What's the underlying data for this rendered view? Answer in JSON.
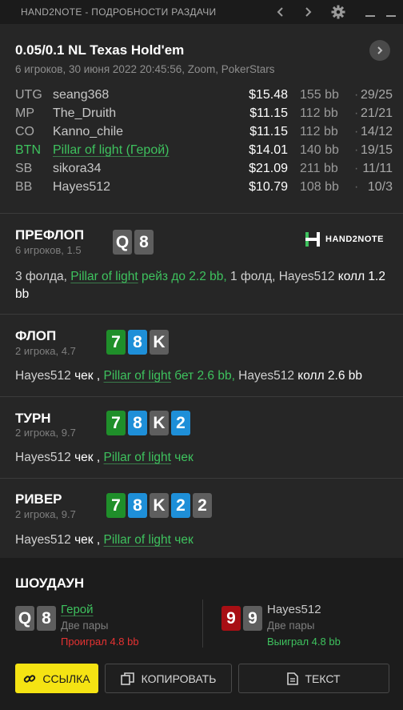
{
  "window": {
    "title": "HAND2NOTE - ПОДРОБНОСТИ РАЗДАЧИ",
    "icons": [
      "chevron-left-icon",
      "chevron-right-icon",
      "gear-icon",
      "minimize-icon",
      "close-icon"
    ]
  },
  "header": {
    "game": "0.05/0.1 NL Texas Hold'em",
    "subtitle": "6 игроков, 30 июня 2022 20:45:56, Zoom, PokerStars"
  },
  "players": [
    {
      "pos": "UTG",
      "name": "seang368",
      "stack": "$15.48",
      "bb": "155 bb",
      "dot": "·",
      "stats": "29/25"
    },
    {
      "pos": "MP",
      "name": "The_Druith",
      "stack": "$11.15",
      "bb": "112 bb",
      "dot": "·",
      "stats": "21/21"
    },
    {
      "pos": "CO",
      "name": "Kanno_chile",
      "stack": "$11.15",
      "bb": "112 bb",
      "dot": "·",
      "stats": "14/12"
    },
    {
      "pos": "BTN",
      "name": "Pillar of light (Герой)",
      "stack": "$14.01",
      "bb": "140 bb",
      "dot": "·",
      "stats": "19/15"
    },
    {
      "pos": "SB",
      "name": "sikora34",
      "stack": "$21.09",
      "bb": "211 bb",
      "dot": "·",
      "stats": "11/11"
    },
    {
      "pos": "BB",
      "name": "Hayes512",
      "stack": "$10.79",
      "bb": "108 bb",
      "dot": "·",
      "stats": "10/3"
    }
  ],
  "logo": {
    "text": "HAND2NOTE"
  },
  "preflop": {
    "title": "ПРЕФЛОП",
    "sub": "6 игроков, 1.5",
    "cards": [
      "Q",
      "8"
    ],
    "a1": "3 фолда, ",
    "a2": "Pillar of light",
    "a3": " рейз до 2.2 bb,",
    "a4": " 1 фолд, ",
    "a5": "Hayes512",
    "a6": " колл 1.2 bb"
  },
  "flop": {
    "title": "ФЛОП",
    "sub": "2 игрока, 4.7",
    "cards": [
      "7",
      "8",
      "K"
    ],
    "a1": "Hayes512",
    "a2": " чек",
    "a3": " , ",
    "a4": "Pillar of light",
    "a5": " бет 2.6 bb,",
    "a6": " Hayes512",
    "a7": " колл 2.6 bb"
  },
  "turn": {
    "title": "ТУРН",
    "sub": "2 игрока, 9.7",
    "cards": [
      "7",
      "8",
      "K",
      "2"
    ],
    "a1": "Hayes512",
    "a2": " чек",
    "a3": " , ",
    "a4": "Pillar of light",
    "a5": " чек"
  },
  "river": {
    "title": "РИВЕР",
    "sub": "2 игрока, 9.7",
    "cards": [
      "7",
      "8",
      "K",
      "2",
      "2"
    ],
    "a1": "Hayes512",
    "a2": " чек",
    "a3": " , ",
    "a4": "Pillar of light",
    "a5": " чек"
  },
  "showdown": {
    "title": "ШОУДАУН",
    "hero": {
      "cards": [
        "Q",
        "8"
      ],
      "name": "Герой",
      "hand": "Две пары",
      "result": "Проиграл 4.8 bb"
    },
    "villain": {
      "cards": [
        "9",
        "9"
      ],
      "name": "Hayes512",
      "hand": "Две пары",
      "result": "Выиграл 4.8 bb"
    }
  },
  "buttons": {
    "link": "ССЫЛКА",
    "copy": "КОПИРОВАТЬ",
    "text": "ТЕКСТ"
  },
  "colors": {
    "accent_green": "#3ec25e",
    "loss_red": "#e53232",
    "button_yellow": "#f5e313",
    "card_green": "#1f8f2a",
    "card_blue": "#1e8fd8",
    "card_red": "#a80f14",
    "card_grey": "#5e5e5e"
  }
}
